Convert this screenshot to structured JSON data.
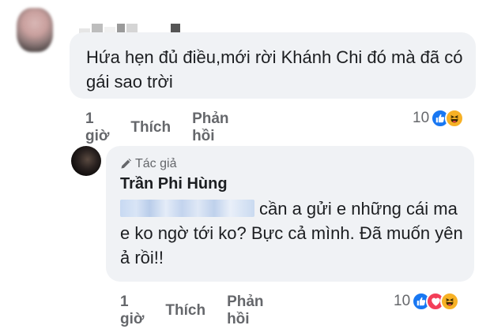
{
  "comment_1": {
    "text": "Hứa hẹn đủ điều,mới rời Khánh Chi đó mà đã có gái sao trời",
    "time": "1 giờ",
    "like_label": "Thích",
    "reply_label": "Phản hồi",
    "reaction_count": "10",
    "reactions": [
      "like-icon",
      "haha-icon"
    ]
  },
  "reply_1": {
    "badge": "Tác giả",
    "author": "Trần Phi Hùng",
    "text": "cần a gửi e những cái ma e ko ngờ tới ko? Bực cả mình. Đã muốn yên ả rồi!!",
    "time": "1 giờ",
    "like_label": "Thích",
    "reply_label": "Phản hồi",
    "reaction_count": "10",
    "reactions": [
      "like-icon",
      "love-icon",
      "haha-icon"
    ]
  },
  "colors": {
    "bubble": "#f0f2f5",
    "meta_text": "#65676b",
    "like": "#1877f2",
    "love": "#f33e58",
    "haha": "#f7b125"
  }
}
